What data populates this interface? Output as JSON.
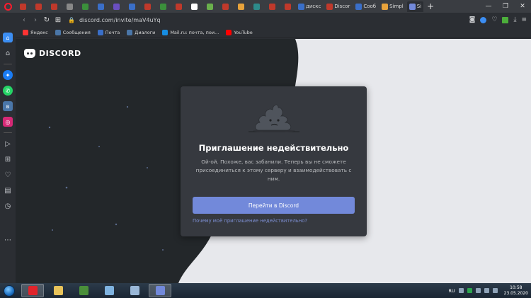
{
  "browser": {
    "url": "discord.com/invite/maV4uYq",
    "tabs": [
      {
        "label": "",
        "color": "#c0392b"
      },
      {
        "label": "",
        "color": "#c0392b"
      },
      {
        "label": "",
        "color": "#c0392b"
      },
      {
        "label": "",
        "color": "#888888"
      },
      {
        "label": "",
        "color": "#3b8f3b"
      },
      {
        "label": "",
        "color": "#3a6fc9"
      },
      {
        "label": "",
        "color": "#6a4fc0"
      },
      {
        "label": "",
        "color": "#3a6fc9"
      },
      {
        "label": "",
        "color": "#c0392b"
      },
      {
        "label": "",
        "color": "#3b8f3b"
      },
      {
        "label": "",
        "color": "#c0392b"
      },
      {
        "label": "",
        "color": "#ffffff"
      },
      {
        "label": "",
        "color": "#6ab04c"
      },
      {
        "label": "",
        "color": "#c0392b"
      },
      {
        "label": "",
        "color": "#e8a33b"
      },
      {
        "label": "",
        "color": "#2d8a8a"
      },
      {
        "label": "",
        "color": "#c0392b"
      },
      {
        "label": "",
        "color": "#c0392b"
      },
      {
        "label": "дискс",
        "color": "#3a6fc9"
      },
      {
        "label": "Discor",
        "color": "#c0392b"
      },
      {
        "label": "Сооб",
        "color": "#3a6fc9"
      },
      {
        "label": "Simpl",
        "color": "#e8a33b"
      },
      {
        "label": "Si",
        "color": "#7289da",
        "active": true
      }
    ],
    "bookmarks": [
      {
        "label": "Яндекс",
        "color": "#ff3333"
      },
      {
        "label": "Сообщения",
        "color": "#4a76a8"
      },
      {
        "label": "Почта",
        "color": "#3a6fc9"
      },
      {
        "label": "Диалоги",
        "color": "#4a76a8"
      },
      {
        "label": "Mail.ru: почта, пои...",
        "color": "#168de2"
      },
      {
        "label": "YouTube",
        "color": "#ff0000"
      }
    ]
  },
  "page": {
    "logo_text": "DISCORD",
    "card": {
      "title": "Приглашение недействительно",
      "description": "Ой-ой. Похоже, вас забанили. Теперь вы не сможете присоединиться к этому серверу и взаимодействовать с ним.",
      "button_label": "Перейти в Discord",
      "link_label": "Почему моё приглашение недействительно?"
    }
  },
  "taskbar": {
    "apps": [
      {
        "name": "opera",
        "color": "#e0242b",
        "active": true
      },
      {
        "name": "explorer",
        "color": "#e8c35a"
      },
      {
        "name": "media-player",
        "color": "#4a8f3a"
      },
      {
        "name": "notepad",
        "color": "#7fb3e0"
      },
      {
        "name": "paint",
        "color": "#9ab8d8"
      },
      {
        "name": "discord",
        "color": "#7289da",
        "active": true
      }
    ],
    "lang": "RU",
    "time": "10:58",
    "date": "23.05.2020"
  },
  "colors": {
    "discord_blurple": "#7289da",
    "card_bg": "#36393f",
    "page_bg_dark": "#23272a",
    "page_bg_light": "#e7e8ec"
  }
}
